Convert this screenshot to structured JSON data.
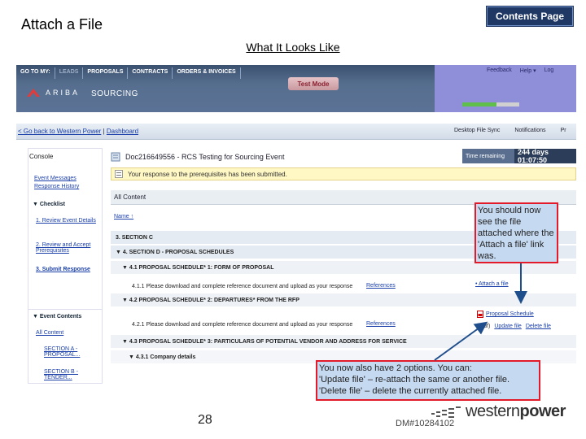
{
  "slide": {
    "title": "Attach a File",
    "contents_button": "Contents Page",
    "subtitle": "What It Looks Like",
    "page_number": "28",
    "doc_number": "DM#10284102",
    "logo_text_light": "western",
    "logo_text_bold": "power"
  },
  "app": {
    "nav": [
      "GO TO MY:",
      "LEADS",
      "PROPOSALS",
      "CONTRACTS",
      "ORDERS & INVOICES"
    ],
    "test_mode": "Test Mode",
    "brand": "ARIBA",
    "module": "SOURCING",
    "right_links": [
      "Feedback",
      "Help ▾",
      "Log"
    ],
    "back_link": "< Go back to Western Power",
    "dashboard_link": "Dashboard",
    "crumb_right": [
      "Desktop File Sync",
      "Notifications",
      "Pr"
    ],
    "sidebar": {
      "title": "Console",
      "links": [
        "Event Messages",
        "Response History"
      ],
      "checklist_title": "Checklist",
      "checklist": [
        "1. Review Event Details",
        "2. Review and Accept Prerequisites",
        "3. Submit Response"
      ],
      "event_contents_title": "Event Contents",
      "event_contents_all": "All Content",
      "event_contents_items": [
        "SECTION A - PROPOSAL...",
        "SECTION B - TENDER..."
      ]
    },
    "doc_title": "Doc216649556 - RCS Testing for Sourcing Event",
    "time_label": "Time remaining",
    "time_value": "244 days 01:07:50",
    "notice": "Your response to the prerequisites has been submitted.",
    "all_content": "All Content",
    "name_header": "Name ↑",
    "rows": [
      {
        "text": "3. SECTION C",
        "kind": "sec"
      },
      {
        "text": "▼ 4. SECTION D - PROPOSAL SCHEDULES",
        "kind": "sec"
      },
      {
        "text": "▼ 4.1 PROPOSAL SCHEDULE* 1: FORM OF PROPOSAL",
        "kind": "sub"
      },
      {
        "text": "4.1.1  Please download and complete reference document and upload as your response",
        "kind": "item",
        "ref": "References",
        "action": "• Attach a file"
      },
      {
        "text": "▼ 4.2 PROPOSAL SCHEDULE* 2: DEPARTURES* FROM THE RFP",
        "kind": "sub"
      },
      {
        "text": "4.2.1  Please download and complete reference document and upload as your response",
        "kind": "item",
        "ref": "References",
        "action": "Proposal Schedule"
      },
      {
        "text": "▼ 4.3 PROPOSAL SCHEDULE* 3: PARTICULARS OF POTENTIAL VENDOR AND ADDRESS FOR SERVICE",
        "kind": "sub"
      },
      {
        "text": "▼ 4.3.1  Company details",
        "kind": "sub"
      }
    ],
    "file_actions": [
      "Update file",
      "Delete file"
    ],
    "file_prefix": "(.pdf)"
  },
  "callouts": {
    "a": "You should now see the file attached where the 'Attach a file' link was.",
    "b_line1": "You now also have 2 options. You can:",
    "b_line2": "'Update file' –  re-attach the same or another file.",
    "b_line3": "'Delete file' – delete the currently attached file."
  },
  "colors": {
    "callout_fill": "#c5d9f1",
    "callout_border": "#e21a2a",
    "arrow": "#1f4e8c",
    "button_bg": "#1f3864"
  }
}
